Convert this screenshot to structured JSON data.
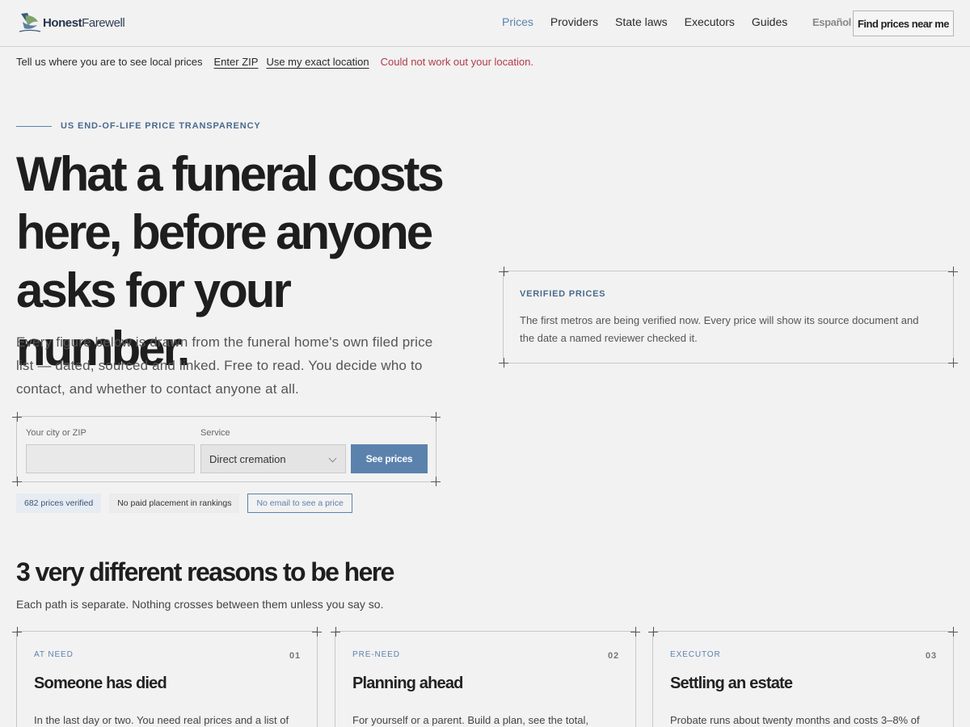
{
  "brand": {
    "name_bold": "Honest",
    "name_rest": "Farewell",
    "logo_icon": "dove-icon"
  },
  "nav": {
    "items": [
      {
        "label": "Prices",
        "active": true
      },
      {
        "label": "Providers"
      },
      {
        "label": "State laws"
      },
      {
        "label": "Executors"
      },
      {
        "label": "Guides"
      }
    ],
    "language": "Español",
    "cta": "Find prices near me"
  },
  "location": {
    "prompt": "Tell us where you are to see local prices",
    "enter_zip": "Enter ZIP",
    "use_location": "Use my exact location",
    "error": "Could not work out your location."
  },
  "hero": {
    "eyebrow": "US END-OF-LIFE PRICE TRANSPARENCY",
    "headline": "What a funeral costs here, before anyone asks for your number.",
    "lede": "Every figure below is drawn from the funeral home's own filed price list — dated, sourced and linked. Free to read. You decide who to contact, and whether to contact anyone at all."
  },
  "search": {
    "city_label": "Your city or ZIP",
    "city_value": "",
    "city_placeholder": "",
    "service_label": "Service",
    "service_selected": "Direct cremation",
    "submit": "See prices"
  },
  "badges": {
    "verified": "682 prices verified",
    "no_paid": "No paid placement in rankings",
    "no_email": "No email to see a price"
  },
  "verified_card": {
    "title": "VERIFIED PRICES",
    "body": "The first metros are being verified now. Every price will show its source document and the date a named reviewer checked it."
  },
  "reasons": {
    "title": "3 very different reasons to be here",
    "subtitle": "Each path is separate. Nothing crosses between them unless you say so.",
    "cards": [
      {
        "tag": "AT NEED",
        "num": "01",
        "title": "Someone has died",
        "text": "In the last day or two. You need real prices and a list of"
      },
      {
        "tag": "PRE-NEED",
        "num": "02",
        "title": "Planning ahead",
        "text": "For yourself or a parent. Build a plan, see the total,"
      },
      {
        "tag": "EXECUTOR",
        "num": "03",
        "title": "Settling an estate",
        "text": "Probate runs about twenty months and costs 3–8% of"
      }
    ]
  },
  "colors": {
    "accent": "#5b82ad",
    "error": "#b23a48",
    "background": "#f2f2f2"
  }
}
